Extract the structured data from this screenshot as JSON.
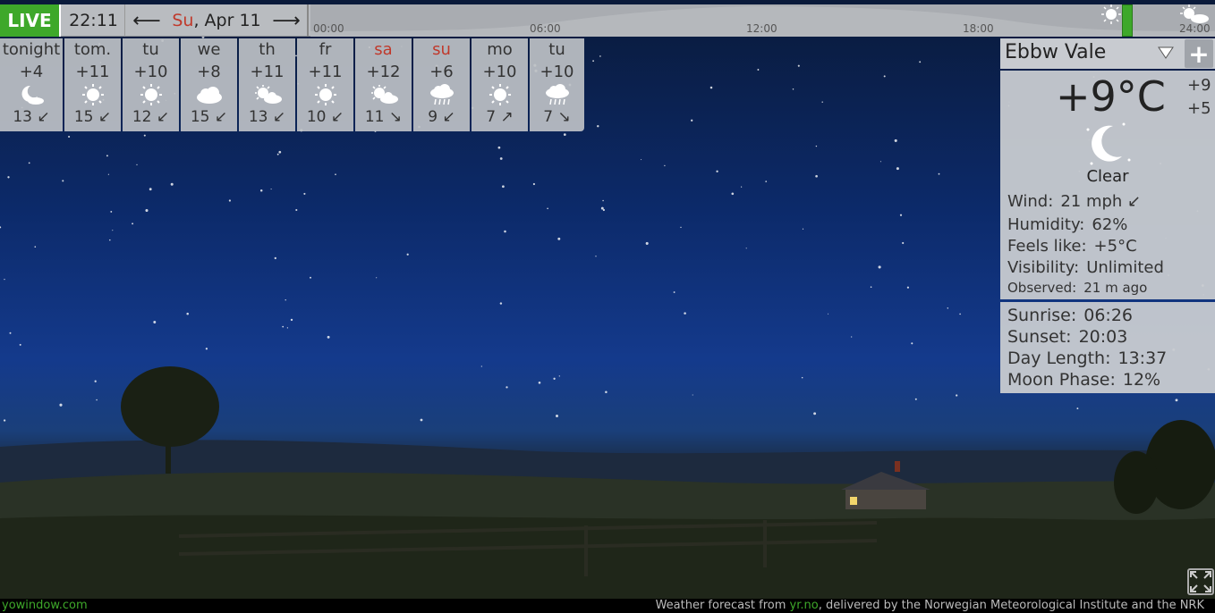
{
  "topbar": {
    "live_label": "LIVE",
    "time": "22:11",
    "prev_icon": "left-arrow-icon",
    "next_icon": "right-arrow-icon",
    "date_dow": "Su",
    "date_rest": ", Apr 11",
    "ticks": [
      "00:00",
      "06:00",
      "12:00",
      "18:00",
      "24:00"
    ]
  },
  "forecast": [
    {
      "day": "tonight",
      "temp": "+4",
      "icon": "moon-cloud-icon",
      "wind": "13 ↙",
      "weekend": false
    },
    {
      "day": "tom.",
      "temp": "+11",
      "icon": "sun-icon",
      "wind": "15 ↙",
      "weekend": false
    },
    {
      "day": "tu",
      "temp": "+10",
      "icon": "sun-icon",
      "wind": "12 ↙",
      "weekend": false
    },
    {
      "day": "we",
      "temp": "+8",
      "icon": "cloud-icon",
      "wind": "15 ↙",
      "weekend": false
    },
    {
      "day": "th",
      "temp": "+11",
      "icon": "sun-cloud-icon",
      "wind": "13 ↙",
      "weekend": false
    },
    {
      "day": "fr",
      "temp": "+11",
      "icon": "sun-icon",
      "wind": "10 ↙",
      "weekend": false
    },
    {
      "day": "sa",
      "temp": "+12",
      "icon": "sun-cloud-icon",
      "wind": "11 ↘",
      "weekend": true
    },
    {
      "day": "su",
      "temp": "+6",
      "icon": "rain-cloud-icon",
      "wind": "9 ↙",
      "weekend": true
    },
    {
      "day": "mo",
      "temp": "+10",
      "icon": "sun-icon",
      "wind": "7 ↗",
      "weekend": false
    },
    {
      "day": "tu",
      "temp": "+10",
      "icon": "rain-cloud-icon",
      "wind": "7 ↘",
      "weekend": false
    }
  ],
  "panel": {
    "city": "Ebbw Vale",
    "add_label": "+",
    "temp": "+9°C",
    "hi": "+9",
    "lo": "+5",
    "condition": "Clear",
    "wind_k": "Wind:",
    "wind_v": "21 mph  ↙",
    "humidity_k": "Humidity:",
    "humidity_v": "62%",
    "feels_k": "Feels like:",
    "feels_v": "+5°C",
    "visibility_k": "Visibility:",
    "visibility_v": "Unlimited",
    "observed_k": "Observed:",
    "observed_v": "21 m ago",
    "sunrise_k": "Sunrise:",
    "sunrise_v": "06:26",
    "sunset_k": "Sunset:",
    "sunset_v": "20:03",
    "daylen_k": "Day Length:",
    "daylen_v": "13:37",
    "moon_k": "Moon Phase:",
    "moon_v": "12%"
  },
  "footer": {
    "site": "yowindow.com",
    "credit_pre": "Weather forecast from ",
    "credit_link": "yr.no",
    "credit_post": ", delivered by the Norwegian Meteorological Institute and the NRK"
  },
  "colors": {
    "accent_green": "#3ea82a",
    "weekend_red": "#c0392b",
    "sky_top": "#0a1a3a",
    "sky_bottom": "#143a8c"
  }
}
